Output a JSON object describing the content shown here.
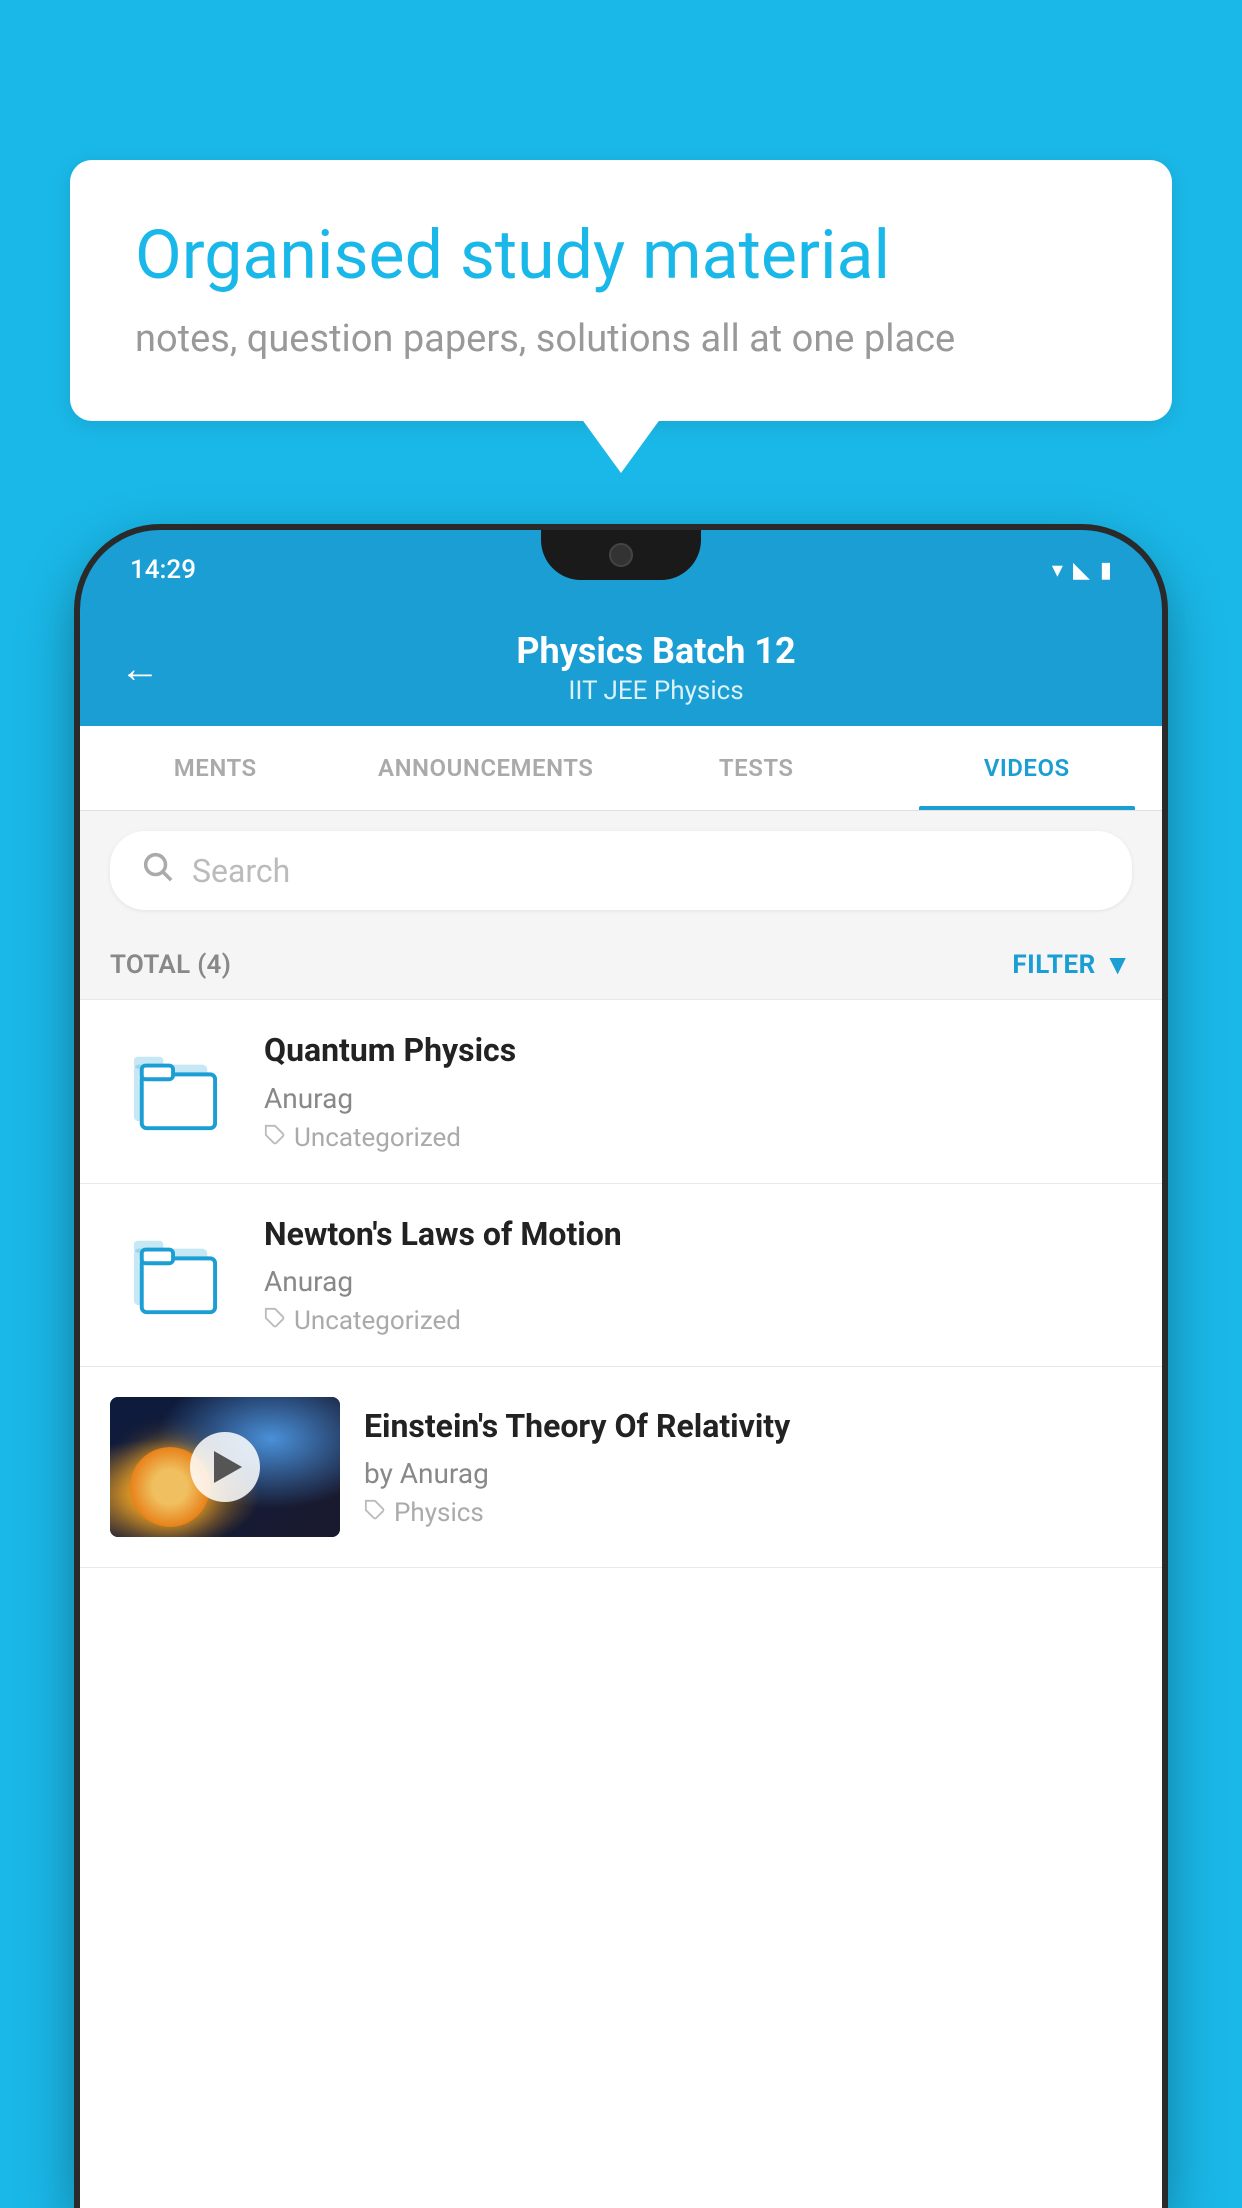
{
  "background_color": "#1ab8e8",
  "speech_bubble": {
    "title": "Organised study material",
    "subtitle": "notes, question papers, solutions all at one place"
  },
  "phone": {
    "status_bar": {
      "time": "14:29"
    },
    "header": {
      "title": "Physics Batch 12",
      "subtitle": "IIT JEE   Physics",
      "back_label": "←"
    },
    "tabs": [
      {
        "label": "MENTS",
        "active": false
      },
      {
        "label": "ANNOUNCEMENTS",
        "active": false
      },
      {
        "label": "TESTS",
        "active": false
      },
      {
        "label": "VIDEOS",
        "active": true
      }
    ],
    "search": {
      "placeholder": "Search"
    },
    "total_bar": {
      "total_text": "TOTAL (4)",
      "filter_label": "FILTER"
    },
    "videos": [
      {
        "title": "Quantum Physics",
        "author": "Anurag",
        "tag": "Uncategorized",
        "type": "folder",
        "has_thumbnail": false
      },
      {
        "title": "Newton's Laws of Motion",
        "author": "Anurag",
        "tag": "Uncategorized",
        "type": "folder",
        "has_thumbnail": false
      },
      {
        "title": "Einstein's Theory Of Relativity",
        "author": "by Anurag",
        "tag": "Physics",
        "type": "video",
        "has_thumbnail": true
      }
    ]
  }
}
